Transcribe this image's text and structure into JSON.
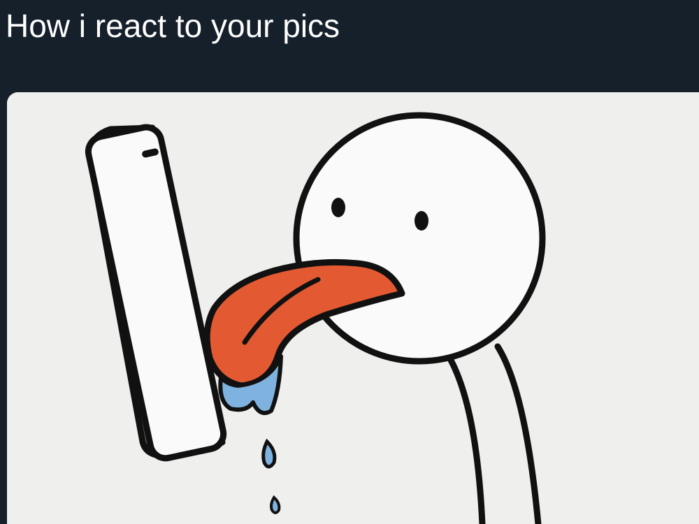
{
  "post": {
    "caption": "How i react to your pics"
  },
  "media": {
    "type": "cartoon-illustration",
    "colors": {
      "header_background": "#15202b",
      "panel_background": "#efefed",
      "outline": "#111111",
      "tongue": "#e35a32",
      "drool": "#7fb2de",
      "phone_side": "#8d8d8d"
    }
  }
}
